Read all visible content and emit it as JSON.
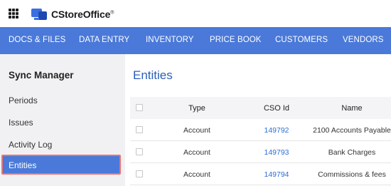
{
  "app": {
    "name": "CStoreOffice",
    "trademark": "®"
  },
  "nav": {
    "items": [
      {
        "label": "DOCS & FILES"
      },
      {
        "label": "DATA ENTRY"
      },
      {
        "label": "INVENTORY"
      },
      {
        "label": "PRICE BOOK"
      },
      {
        "label": "CUSTOMERS"
      },
      {
        "label": "VENDORS"
      }
    ]
  },
  "sidebar": {
    "title": "Sync Manager",
    "items": [
      {
        "label": "Periods"
      },
      {
        "label": "Issues"
      },
      {
        "label": "Activity Log"
      },
      {
        "label": "Entities",
        "active": true
      }
    ]
  },
  "main": {
    "title": "Entities",
    "table": {
      "columns": [
        "Type",
        "CSO Id",
        "Name"
      ],
      "rows": [
        {
          "type": "Account",
          "cso_id": "149792",
          "name": "2100 Accounts Payable"
        },
        {
          "type": "Account",
          "cso_id": "149793",
          "name": "Bank Charges"
        },
        {
          "type": "Account",
          "cso_id": "149794",
          "name": "Commissions & fees"
        }
      ]
    }
  },
  "colors": {
    "accent": "#4a79d9",
    "link": "#2b6ed6",
    "highlight_border": "#e87474"
  },
  "icons": {
    "apps": "apps-grid-icon",
    "logo": "monitor-logo-icon"
  }
}
